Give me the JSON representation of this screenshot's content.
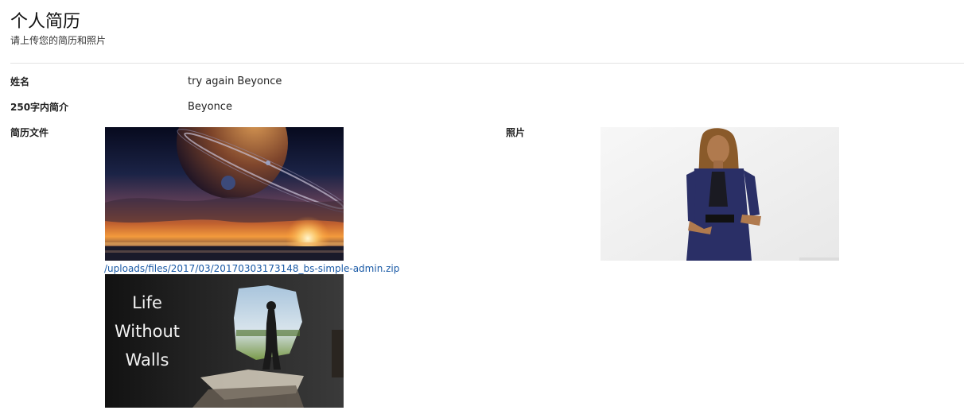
{
  "header": {
    "title": "个人简历",
    "subtitle": "请上传您的简历和照片"
  },
  "fields": {
    "name_label": "姓名",
    "name_value": "try again Beyonce",
    "intro_label": "250字内简介",
    "intro_value": "Beyonce",
    "file_label": "简历文件",
    "photo_label": "照片"
  },
  "resume_file": {
    "link_text": "/uploads/files/2017/03/20170303173148_bs-simple-admin.zip",
    "images": [
      {
        "name": "planet-sunset-image"
      },
      {
        "name": "life-without-walls-image",
        "text_lines": [
          "Life",
          "Without",
          "Walls"
        ]
      }
    ]
  },
  "photo": {
    "name": "portrait-photo"
  },
  "colors": {
    "link": "#1a5aa6",
    "divider": "#e2e2e2"
  }
}
